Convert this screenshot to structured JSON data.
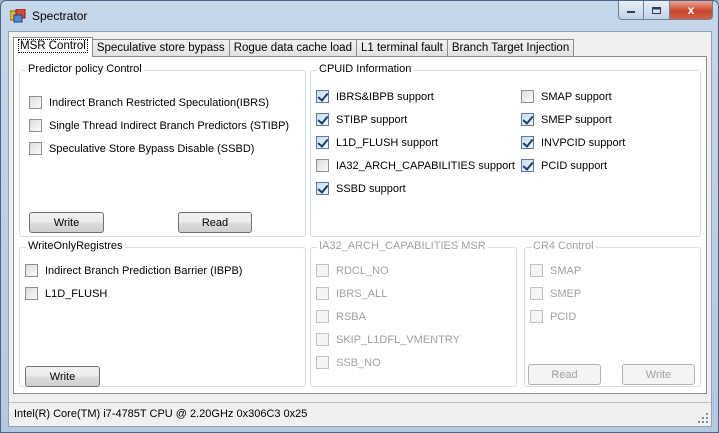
{
  "window": {
    "title": "Spectrator",
    "close_glyph": "x"
  },
  "tabs": [
    {
      "label": "MSR Control",
      "active": true
    },
    {
      "label": "Speculative store bypass"
    },
    {
      "label": "Rogue data cache load"
    },
    {
      "label": "L1 terminal fault"
    },
    {
      "label": "Branch Target Injection"
    }
  ],
  "predictor": {
    "title": "Predictor policy Control",
    "options": [
      {
        "label": "Indirect Branch Restricted Speculation(IBRS)",
        "checked": false
      },
      {
        "label": "Single Thread Indirect Branch Predictors (STIBP)",
        "checked": false
      },
      {
        "label": "Speculative Store Bypass Disable (SSBD)",
        "checked": false
      }
    ],
    "write_label": "Write",
    "read_label": "Read"
  },
  "writeonly": {
    "title": "WriteOnlyRegistres",
    "options": [
      {
        "label": "Indirect Branch Prediction Barrier (IBPB)",
        "checked": false
      },
      {
        "label": "L1D_FLUSH",
        "checked": false
      }
    ],
    "write_label": "Write"
  },
  "cpuid": {
    "title": "CPUID Information",
    "left": [
      {
        "label": "IBRS&IBPB support",
        "checked": true
      },
      {
        "label": "STIBP support",
        "checked": true
      },
      {
        "label": "L1D_FLUSH support",
        "checked": true
      },
      {
        "label": "IA32_ARCH_CAPABILITIES support",
        "checked": false
      },
      {
        "label": "SSBD support",
        "checked": true
      }
    ],
    "right": [
      {
        "label": "SMAP support",
        "checked": false
      },
      {
        "label": "SMEP support",
        "checked": true
      },
      {
        "label": "INVPCID support",
        "checked": true
      },
      {
        "label": "PCID support",
        "checked": true
      }
    ]
  },
  "arch_msr": {
    "title": "IA32_ARCH_CAPABILITIES MSR",
    "options": [
      {
        "label": "RDCL_NO"
      },
      {
        "label": "IBRS_ALL"
      },
      {
        "label": "RSBA"
      },
      {
        "label": "SKIP_L1DFL_VMENTRY"
      },
      {
        "label": "SSB_NO"
      }
    ]
  },
  "cr4": {
    "title": "CR4 Control",
    "options": [
      {
        "label": "SMAP"
      },
      {
        "label": "SMEP"
      },
      {
        "label": "PCID"
      }
    ],
    "read_label": "Read",
    "write_label": "Write"
  },
  "status": {
    "cpu_text": "Intel(R) Core(TM) i7-4785T CPU @ 2.20GHz  0x306C3  0x25"
  }
}
